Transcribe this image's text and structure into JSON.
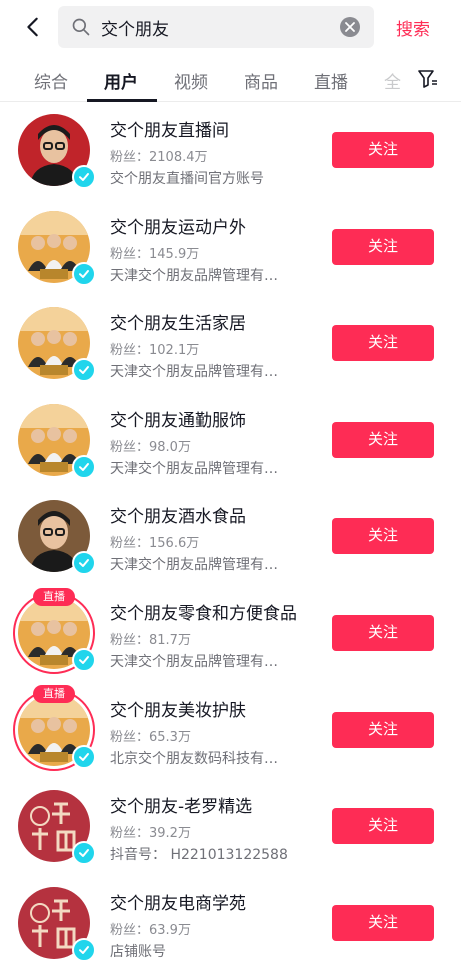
{
  "search": {
    "query": "交个朋友",
    "submit_label": "搜索"
  },
  "tabs": [
    {
      "label": "综合"
    },
    {
      "label": "用户"
    },
    {
      "label": "视频"
    },
    {
      "label": "商品"
    },
    {
      "label": "直播"
    },
    {
      "label": "全"
    }
  ],
  "colors": {
    "accent": "#fe2c55",
    "verified": "#20d5ec",
    "text_primary": "#161823",
    "text_secondary": "#8a8b91"
  },
  "results": [
    {
      "name": "交个朋友直播间",
      "fans": "粉丝：2108.4万",
      "desc": "交个朋友直播间官方账号",
      "follow": "关注",
      "live": false,
      "avatar": "portrait-man-glasses-icon"
    },
    {
      "name": "交个朋友运动户外",
      "fans": "粉丝：145.9万",
      "desc": "天津交个朋友品牌管理有…",
      "follow": "关注",
      "live": false,
      "avatar": "group-photo-icon"
    },
    {
      "name": "交个朋友生活家居",
      "fans": "粉丝：102.1万",
      "desc": "天津交个朋友品牌管理有…",
      "follow": "关注",
      "live": false,
      "avatar": "group-photo-icon"
    },
    {
      "name": "交个朋友通勤服饰",
      "fans": "粉丝：98.0万",
      "desc": "天津交个朋友品牌管理有…",
      "follow": "关注",
      "live": false,
      "avatar": "group-photo-icon"
    },
    {
      "name": "交个朋友酒水食品",
      "fans": "粉丝：156.6万",
      "desc": "天津交个朋友品牌管理有…",
      "follow": "关注",
      "live": false,
      "avatar": "portrait-man-glasses-icon"
    },
    {
      "name": "交个朋友零食和方便食品",
      "fans": "粉丝：81.7万",
      "desc": "天津交个朋友品牌管理有…",
      "follow": "关注",
      "live": true,
      "live_label": "直播",
      "avatar": "group-photo-icon"
    },
    {
      "name": "交个朋友美妆护肤",
      "fans": "粉丝：65.3万",
      "desc": "北京交个朋友数码科技有…",
      "follow": "关注",
      "live": true,
      "live_label": "直播",
      "avatar": "group-photo-icon"
    },
    {
      "name": "交个朋友-老罗精选",
      "fans": "粉丝：39.2万",
      "desc": "抖音号： H221013122588",
      "follow": "关注",
      "live": false,
      "avatar": "jiaogepengyou-logo-icon"
    },
    {
      "name": "交个朋友电商学苑",
      "fans": "粉丝：63.9万",
      "desc": "店铺账号",
      "follow": "关注",
      "live": false,
      "avatar": "jiaogepengyou-logo-icon"
    }
  ]
}
